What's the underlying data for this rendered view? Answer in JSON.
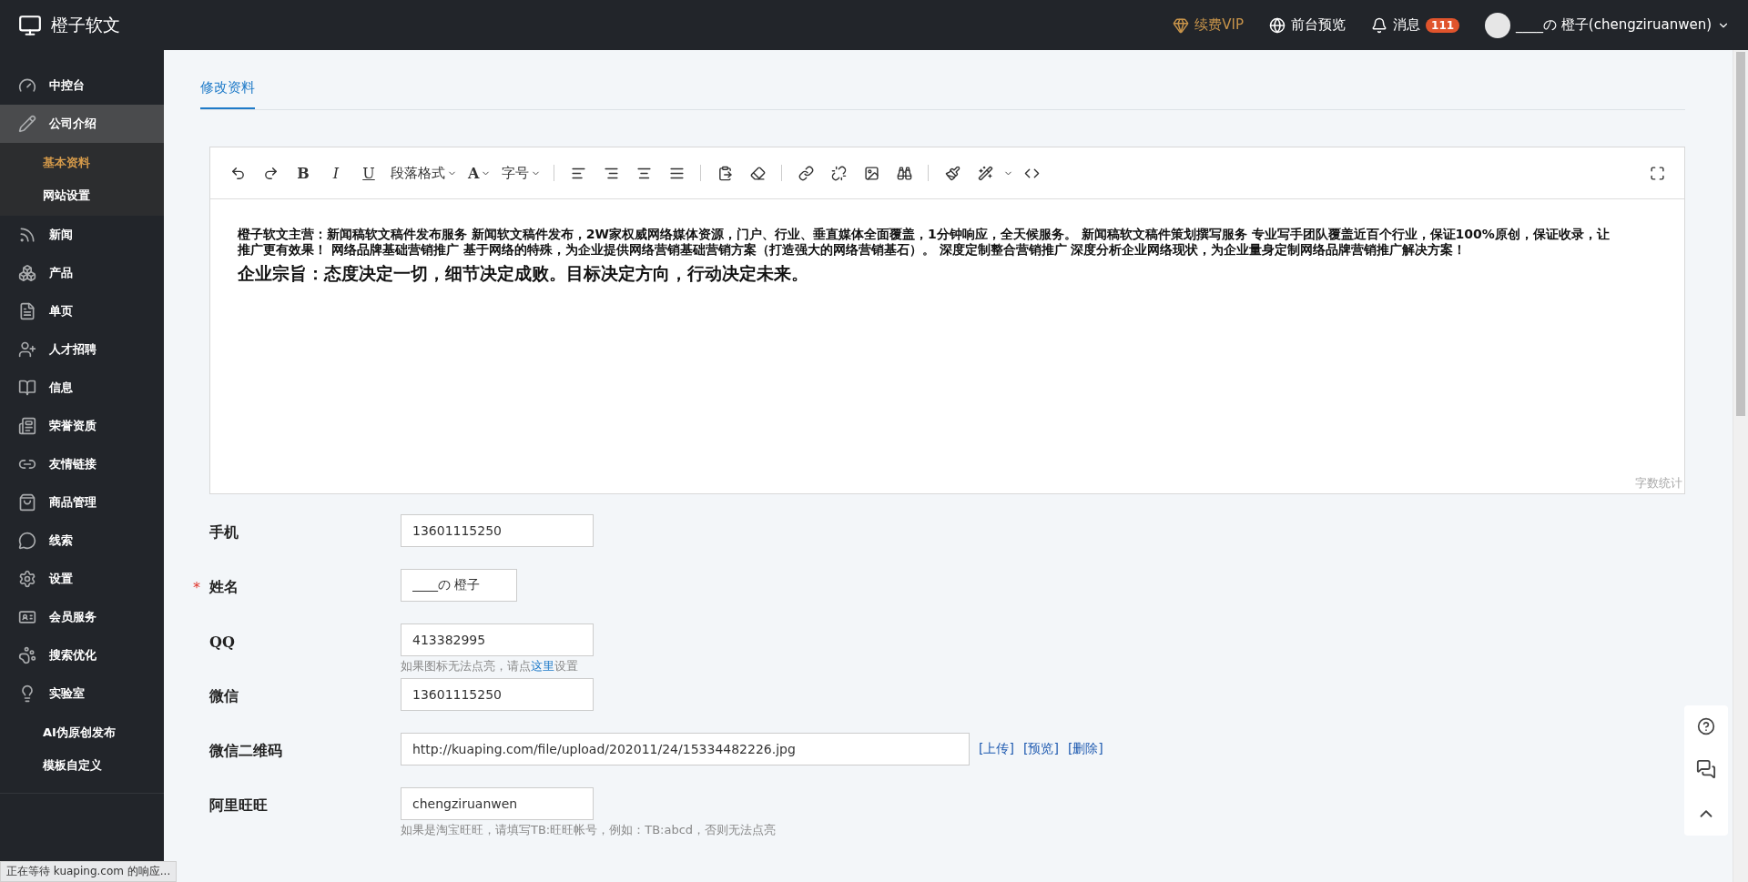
{
  "topbar": {
    "logo": "橙子软文",
    "vip": "续费VIP",
    "preview": "前台预览",
    "messages": "消息",
    "message_count": "111",
    "user": "____の 橙子(chengziruanwen)"
  },
  "sidebar": {
    "items": [
      {
        "label": "中控台",
        "selected": false
      },
      {
        "label": "公司介绍",
        "selected": true,
        "expanded": true,
        "children": [
          {
            "label": "基本资料",
            "selected": true
          },
          {
            "label": "网站设置",
            "selected": false
          }
        ]
      },
      {
        "label": "新闻",
        "selected": false
      },
      {
        "label": "产品",
        "selected": false
      },
      {
        "label": "单页",
        "selected": false
      },
      {
        "label": "人才招聘",
        "selected": false
      },
      {
        "label": "信息",
        "selected": false
      },
      {
        "label": "荣誉资质",
        "selected": false
      },
      {
        "label": "友情链接",
        "selected": false
      },
      {
        "label": "商品管理",
        "selected": false
      },
      {
        "label": "线索",
        "selected": false
      },
      {
        "label": "设置",
        "selected": false
      },
      {
        "label": "会员服务",
        "selected": false
      },
      {
        "label": "搜索优化",
        "selected": false
      },
      {
        "label": "实验室",
        "selected": false,
        "expanded": true,
        "children": [
          {
            "label": "AI伪原创发布",
            "selected": false
          },
          {
            "label": "模板自定义",
            "selected": false
          }
        ]
      }
    ]
  },
  "tabs": [
    {
      "label": "修改资料",
      "selected": true
    }
  ],
  "editor": {
    "toolbar": {
      "bold": "B",
      "italic": "I",
      "underline": "U",
      "paragraph_format": "段落格式",
      "font_color": "A",
      "font_size": "字号"
    },
    "paragraphs": [
      {
        "kind": "normal",
        "text": "橙子软文主营：新闻稿软文稿件发布服务 新闻软文稿件发布，2W家权威网络媒体资源，门户、行业、垂直媒体全面覆盖，1分钟响应，全天候服务。  新闻稿软文稿件策划撰写服务 专业写手团队覆盖近百个行业，保证100%原创，保证收录，让推广更有效果！  网络品牌基础营销推广 基于网络的特殊，为企业提供网络营销基础营销方案（打造强大的网络营销基石）。  深度定制整合营销推广 深度分析企业网络现状，为企业量身定制网络品牌营销推广解决方案！"
      },
      {
        "kind": "large",
        "text": "企业宗旨：态度决定一切，细节决定成败。目标决定方向，行动决定未来。"
      }
    ],
    "word_count": "字数统计"
  },
  "required_mark": "*",
  "form": [
    {
      "label": "手机",
      "kind": "text",
      "required": false,
      "value": "13601115250"
    },
    {
      "label": "姓名",
      "kind": "short",
      "required": true,
      "value": "____の 橙子"
    },
    {
      "label": "QQ",
      "kind": "text",
      "required": false,
      "value": "413382995",
      "hint": {
        "before": "如果图标无法点亮，请点",
        "link": "这里",
        "after": "设置"
      }
    },
    {
      "label": "微信",
      "kind": "text",
      "required": false,
      "value": "13601115250"
    },
    {
      "label": "微信二维码",
      "kind": "wide",
      "required": false,
      "value": "http://kuaping.com/file/upload/202011/24/15334482226.jpg",
      "actions": [
        "[上传]",
        "[预览]",
        "[删除]"
      ]
    },
    {
      "label": "阿里旺旺",
      "kind": "text",
      "required": false,
      "value": "chengziruanwen",
      "hint": {
        "before": "如果是淘宝旺旺，请填写TB:旺旺帐号，例如：TB:abcd，否则无法点亮"
      }
    }
  ],
  "status_bar": "正在等待 kuaping.com 的响应..."
}
